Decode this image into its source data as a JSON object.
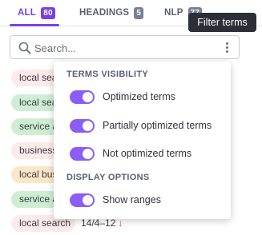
{
  "tabs": [
    {
      "label": "ALL",
      "count": "80",
      "active": true
    },
    {
      "label": "HEADINGS",
      "count": "5",
      "active": false
    },
    {
      "label": "NLP",
      "count": "77",
      "active": false
    }
  ],
  "tooltip": {
    "text": "Filter terms"
  },
  "search": {
    "placeholder": "Search..."
  },
  "terms": [
    {
      "text": "local sea",
      "color": "red"
    },
    {
      "text": "local sea",
      "color": "green"
    },
    {
      "text": "service a",
      "color": "green"
    },
    {
      "text": "business",
      "color": "red"
    },
    {
      "text": "local bus",
      "color": "orange"
    },
    {
      "text": "service a",
      "color": "green"
    },
    {
      "text": "local search",
      "color": "red",
      "count": "14/4–12"
    }
  ],
  "popup": {
    "visibility_title": "TERMS VISIBILITY",
    "visibility_options": [
      {
        "label": "Optimized terms",
        "on": true
      },
      {
        "label": "Partially optimized terms",
        "on": true
      },
      {
        "label": "Not optimized terms",
        "on": true
      }
    ],
    "display_title": "DISPLAY OPTIONS",
    "display_options": [
      {
        "label": "Show ranges",
        "on": true
      }
    ]
  },
  "colors": {
    "accent": "#7b3fe4",
    "toggle": "#8b5cf6",
    "term_red": "#fdeaea",
    "term_green": "#cdeed3",
    "term_orange": "#fbe6c8",
    "down_arrow": "#e04848"
  }
}
